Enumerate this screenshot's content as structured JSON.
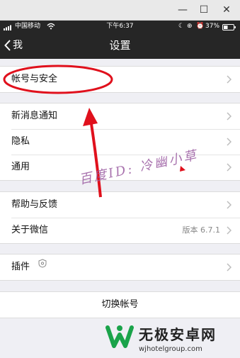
{
  "window": {
    "minimize": "—",
    "maximize": "☐",
    "close": "✕"
  },
  "status_bar": {
    "carrier": "中国移动",
    "time": "下午6:37",
    "battery": "37%"
  },
  "nav": {
    "back_label": "我",
    "title": "设置"
  },
  "sections": {
    "account": {
      "label": "帐号与安全"
    },
    "notifications": {
      "label": "新消息通知"
    },
    "privacy": {
      "label": "隐私"
    },
    "general": {
      "label": "通用"
    },
    "help": {
      "label": "帮助与反馈"
    },
    "about": {
      "label": "关于微信",
      "version": "版本 6.7.1"
    },
    "plugins": {
      "label": "插件"
    },
    "switch_account": {
      "label": "切换帐号"
    }
  },
  "watermark": {
    "text": "百度ID: 冷幽小草"
  },
  "logo": {
    "name": "无极安卓网",
    "url": "wjhotelgroup.com"
  },
  "colors": {
    "nav_background": "#262626",
    "page_background": "#efeff4",
    "annotation_red": "#e0101c",
    "logo_green": "#1aa34a"
  }
}
